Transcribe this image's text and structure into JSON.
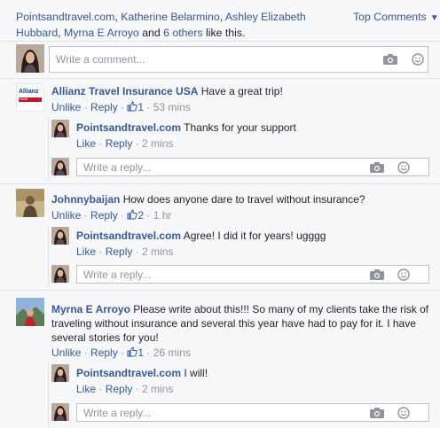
{
  "likes": {
    "names": [
      "Pointsandtravel.com",
      "Katherine Belarmino",
      "Ashley Elizabeth Hubbard",
      "Myrna E Arroyo"
    ],
    "and": "and",
    "others": "6 others",
    "suffix": "like this."
  },
  "sort": {
    "label": "Top Comments"
  },
  "main_comment_box": {
    "placeholder": "Write a comment..."
  },
  "reply_placeholder": "Write a reply...",
  "comments": [
    {
      "author": "Allianz Travel Insurance USA",
      "text": "Have a great trip!",
      "unlike": "Unlike",
      "reply": "Reply",
      "likes": "1",
      "time": "53 mins",
      "reply_item": {
        "author": "Pointsandtravel.com",
        "text": "Thanks for your support",
        "like": "Like",
        "reply": "Reply",
        "time": "2 mins"
      }
    },
    {
      "author": "Johnnybaijan",
      "text": "How does anyone dare to travel without insurance?",
      "unlike": "Unlike",
      "reply": "Reply",
      "likes": "2",
      "time": "1 hr",
      "reply_item": {
        "author": "Pointsandtravel.com",
        "text": "Agree! I did it for years! ugggg",
        "like": "Like",
        "reply": "Reply",
        "time": "2 mins"
      }
    },
    {
      "author": "Myrna E Arroyo",
      "text": "Please write about this!!! So many of my clients take the risk of traveling without insurance and several this year have had to pay for it. I have several stories for you!",
      "unlike": "Unlike",
      "reply": "Reply",
      "likes": "1",
      "time": "26 mins",
      "reply_item": {
        "author": "Pointsandtravel.com",
        "text": "I will!",
        "like": "Like",
        "reply": "Reply",
        "time": "2 mins"
      }
    }
  ],
  "allianz_logo": {
    "word": "Allianz",
    "tagline": "Global Assistance"
  },
  "colors": {
    "link": "#365899",
    "meta": "#90949c",
    "background": "#f6f7f9"
  }
}
